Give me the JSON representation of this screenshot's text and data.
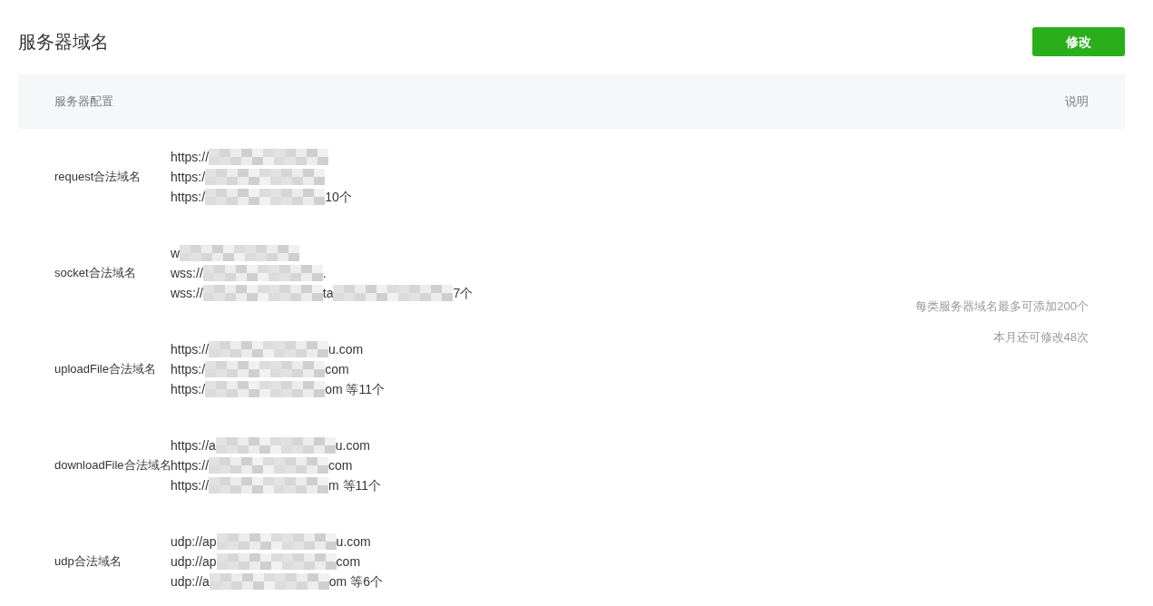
{
  "title": "服务器域名",
  "edit_button": "修改",
  "table": {
    "columns": [
      "服务器配置",
      "说明"
    ],
    "rows": [
      {
        "label": "request合法域名",
        "lines": [
          [
            "https://"
          ],
          [
            "https:/"
          ],
          [
            "https:/",
            "10个"
          ]
        ]
      },
      {
        "label": "socket合法域名",
        "lines": [
          [
            "w"
          ],
          [
            "wss://",
            "."
          ],
          [
            "wss://",
            "ta",
            "7个"
          ]
        ]
      },
      {
        "label": "uploadFile合法域名",
        "lines": [
          [
            "https://",
            "u.com"
          ],
          [
            "https:/",
            "com"
          ],
          [
            "https:/",
            "om 等11个"
          ]
        ]
      },
      {
        "label": "downloadFile合法域名",
        "lines": [
          [
            "https://a",
            "u.com"
          ],
          [
            "https://",
            "com"
          ],
          [
            "https://",
            "m 等11个"
          ]
        ]
      },
      {
        "label": "udp合法域名",
        "lines": [
          [
            "udp://ap",
            "u.com"
          ],
          [
            "udp://ap",
            "com"
          ],
          [
            "udp://a",
            "om 等6个"
          ]
        ]
      }
    ],
    "notes": [
      "每类服务器域名最多可添加200个",
      "本月还可修改48次"
    ]
  }
}
